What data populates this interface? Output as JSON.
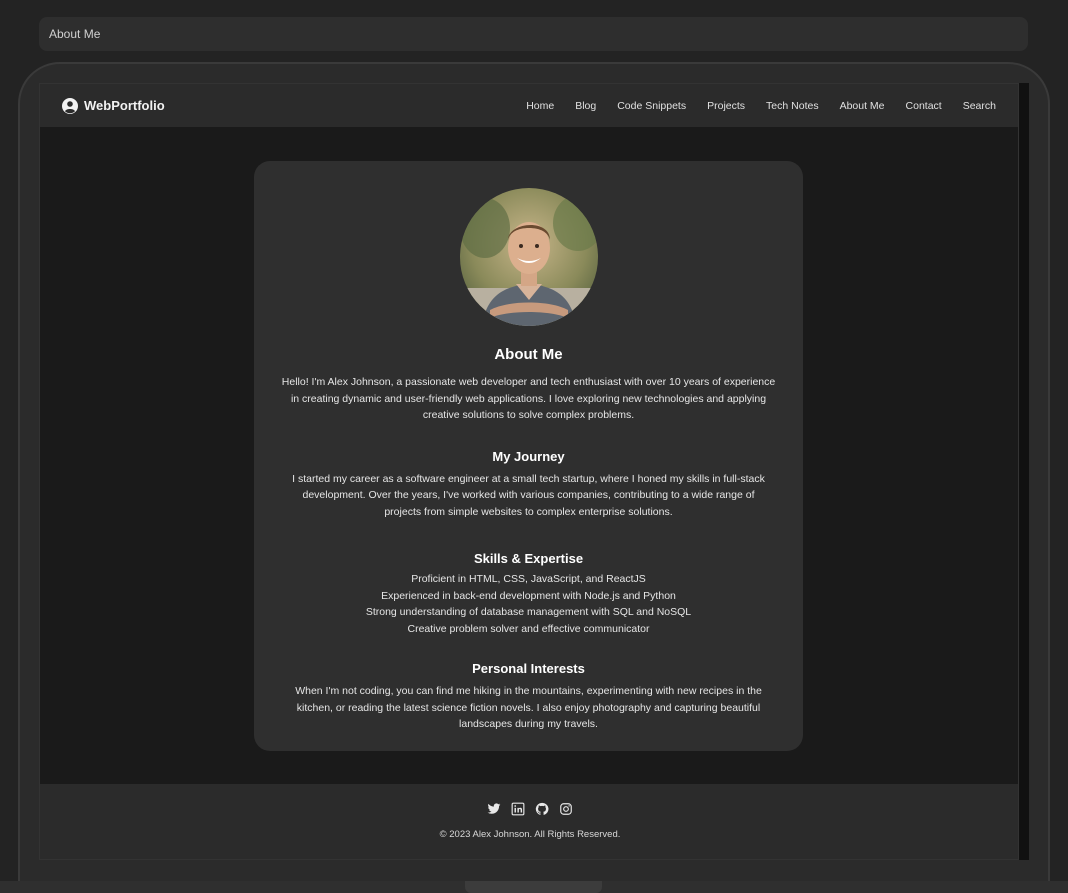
{
  "browser": {
    "tab_title": "About Me"
  },
  "navbar": {
    "brand": "WebPortfolio",
    "links": [
      "Home",
      "Blog",
      "Code Snippets",
      "Projects",
      "Tech Notes",
      "About Me",
      "Contact",
      "Search"
    ]
  },
  "about": {
    "title": "About Me",
    "intro": "Hello! I'm Alex Johnson, a passionate web developer and tech enthusiast with over 10 years of experience in creating dynamic and user-friendly web applications. I love exploring new technologies and applying creative solutions to solve complex problems.",
    "journey_title": "My Journey",
    "journey_text": "I started my career as a software engineer at a small tech startup, where I honed my skills in full-stack development. Over the years, I've worked with various companies, contributing to a wide range of projects from simple websites to complex enterprise solutions.",
    "skills_title": "Skills & Expertise",
    "skills": [
      "Proficient in HTML, CSS, JavaScript, and ReactJS",
      "Experienced in back-end development with Node.js and Python",
      "Strong understanding of database management with SQL and NoSQL",
      "Creative problem solver and effective communicator"
    ],
    "interests_title": "Personal Interests",
    "interests_text": "When I'm not coding, you can find me hiking in the mountains, experimenting with new recipes in the kitchen, or reading the latest science fiction novels. I also enjoy photography and capturing beautiful landscapes during my travels."
  },
  "footer": {
    "social_icons": [
      "twitter-icon",
      "linkedin-icon",
      "github-icon",
      "instagram-icon"
    ],
    "copyright": "© 2023 Alex Johnson. All Rights Reserved."
  }
}
